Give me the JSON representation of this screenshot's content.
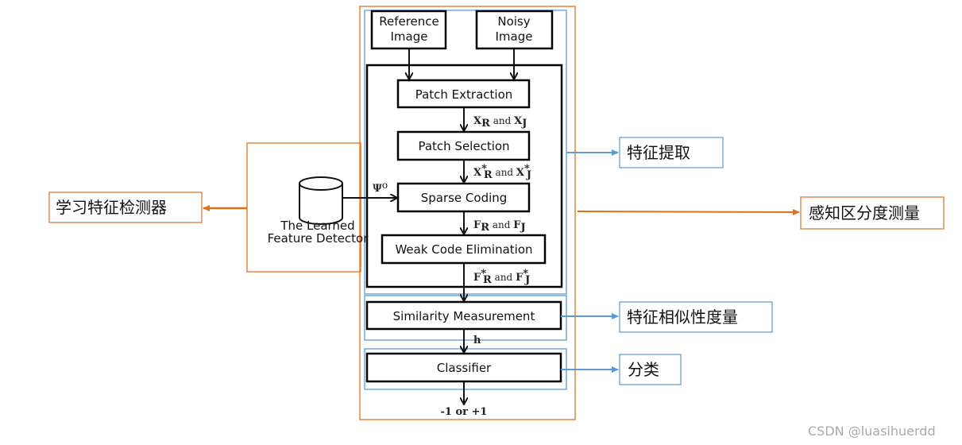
{
  "colors": {
    "orange": "#e07020",
    "blue": "#5b9bd5",
    "black": "#000000"
  },
  "inputs": {
    "reference": [
      "Reference",
      "Image"
    ],
    "noisy": [
      "Noisy",
      "Image"
    ]
  },
  "steps": {
    "patch_extraction": "Patch Extraction",
    "patch_selection": "Patch Selection",
    "sparse_coding": "Sparse Coding",
    "weak_code": "Weak Code Elimination",
    "similarity": "Similarity Measurement",
    "classifier": "Classifier"
  },
  "edge_labels": {
    "x": {
      "a": "X",
      "asub": "R",
      "mid": " and ",
      "b": "X",
      "bsub": "J"
    },
    "xs": {
      "a": "X",
      "asup": "*",
      "asub": "R",
      "mid": " and ",
      "b": "X",
      "bsup": "*",
      "bsub": "J"
    },
    "f": {
      "a": "F",
      "asub": "R",
      "mid": " and ",
      "b": "F",
      "bsub": "J"
    },
    "fs": {
      "a": "F",
      "asup": "*",
      "asub": "R",
      "mid": " and ",
      "b": "F",
      "bsup": "*",
      "bsub": "J"
    },
    "psi": {
      "a": "Ψ",
      "asup": "o"
    },
    "h": "h",
    "output": "-1 or +1"
  },
  "detector": [
    "The Learned",
    "Feature Detector"
  ],
  "annotations": {
    "learned_detector": "学习特征检测器",
    "feature_extraction": "特征提取",
    "perceptual": "感知区分度测量",
    "similarity": "特征相似性度量",
    "classification": "分类"
  },
  "watermark": "CSDN @luasihuerdd"
}
